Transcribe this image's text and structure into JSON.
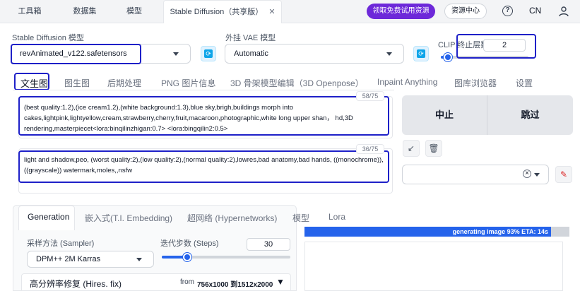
{
  "topbar": {
    "tabs": [
      {
        "label": "工具箱"
      },
      {
        "label": "数据集"
      },
      {
        "label": "模型"
      },
      {
        "label": "Stable Diffusion（共享版）"
      }
    ],
    "promo_label": "领取免费试用资源",
    "resource_center_label": "资源中心",
    "help_glyph": "?",
    "language": "CN"
  },
  "model": {
    "sd_label": "Stable Diffusion 模型",
    "sd_value": "revAnimated_v122.safetensors",
    "vae_label": "外挂 VAE 模型",
    "vae_value": "Automatic",
    "clip_label": "CLIP 终止层数",
    "clip_value": "2",
    "clip_fraction": 0.083
  },
  "main_tabs": [
    {
      "label": "文生图"
    },
    {
      "label": "图生图"
    },
    {
      "label": "后期处理"
    },
    {
      "label": "PNG 图片信息"
    },
    {
      "label": "3D 骨架模型编辑（3D Openpose）"
    },
    {
      "label": "Inpaint Anything"
    },
    {
      "label": "图库浏览器"
    },
    {
      "label": "设置"
    }
  ],
  "prompt": {
    "positive_counter": "58/75",
    "positive_text": "(best quality:1.2),(ice cream1.2),(white background:1.3),blue sky,brigh,buildings morph into cakes,lightpink,lightyellow,cream,strawberry,cherry,fruit,macaroon,photographic,white long upper shan， hd,3D rendering,masterpiecet<lora:binqilinzhigan:0.7> <lora:bingqilin2:0.5>",
    "negative_counter": "36/75",
    "negative_text": "light and shadow,peo, (worst quality:2),(low quality:2),(normal quality:2),lowres,bad anatomy,bad hands, ((monochrome)),((grayscale)) watermark,moles,,nsfw"
  },
  "actions": {
    "interrupt_label": "中止",
    "skip_label": "跳过",
    "arrow_glyph": "↙",
    "trash_glyph": "🗑",
    "clear_glyph": "×",
    "edit_glyph": "✎"
  },
  "generation": {
    "tabs": [
      {
        "label": "Generation"
      },
      {
        "label": "嵌入式(T.I. Embedding)"
      },
      {
        "label": "超网络 (Hypernetworks)"
      },
      {
        "label": "模型"
      },
      {
        "label": "Lora"
      }
    ],
    "sampler_label": "采样方法 (Sampler)",
    "sampler_value": "DPM++ 2M Karras",
    "steps_label": "迭代步数 (Steps)",
    "steps_value": "30",
    "steps_fraction": 0.2,
    "hires_label": "高分辨率修复 (Hires. fix)",
    "hires_from": "from",
    "hires_size": "756x1000 到1512x2000",
    "hires_toggle": "▼"
  },
  "progress": {
    "text": "generating image 93% ETA: 14s",
    "percent": 93
  },
  "colors": {
    "accent": "#2563eb",
    "promo": "#6d28d9",
    "highlight": "#1e20c8"
  }
}
